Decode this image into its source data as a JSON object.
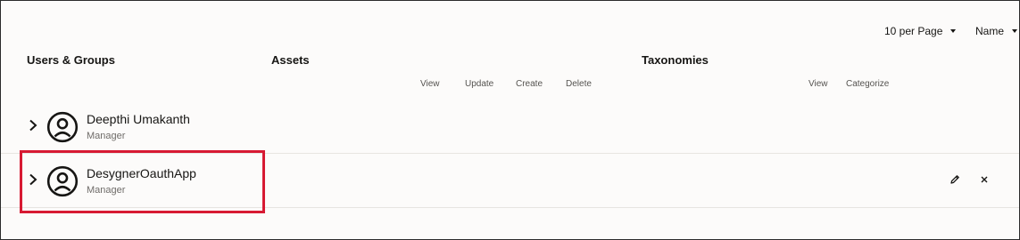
{
  "controls": {
    "per_page": "10 per Page",
    "sort": "Name"
  },
  "columns": {
    "users_groups": "Users & Groups",
    "assets": "Assets",
    "taxonomies": "Taxonomies"
  },
  "asset_permissions": [
    "View",
    "Update",
    "Create",
    "Delete"
  ],
  "taxonomy_permissions": [
    "View",
    "Categorize"
  ],
  "rows": [
    {
      "name": "Deepthi Umakanth",
      "role": "Manager"
    },
    {
      "name": "DesygnerOauthApp",
      "role": "Manager"
    }
  ],
  "icons": {
    "expand": "chevron-right-icon",
    "avatar": "user-avatar-icon",
    "edit": "pencil-icon",
    "remove": "close-icon",
    "dropdown": "caret-down-icon"
  },
  "colors": {
    "highlight": "#d71a33",
    "text": "#161513",
    "background": "#fcfbfa"
  }
}
